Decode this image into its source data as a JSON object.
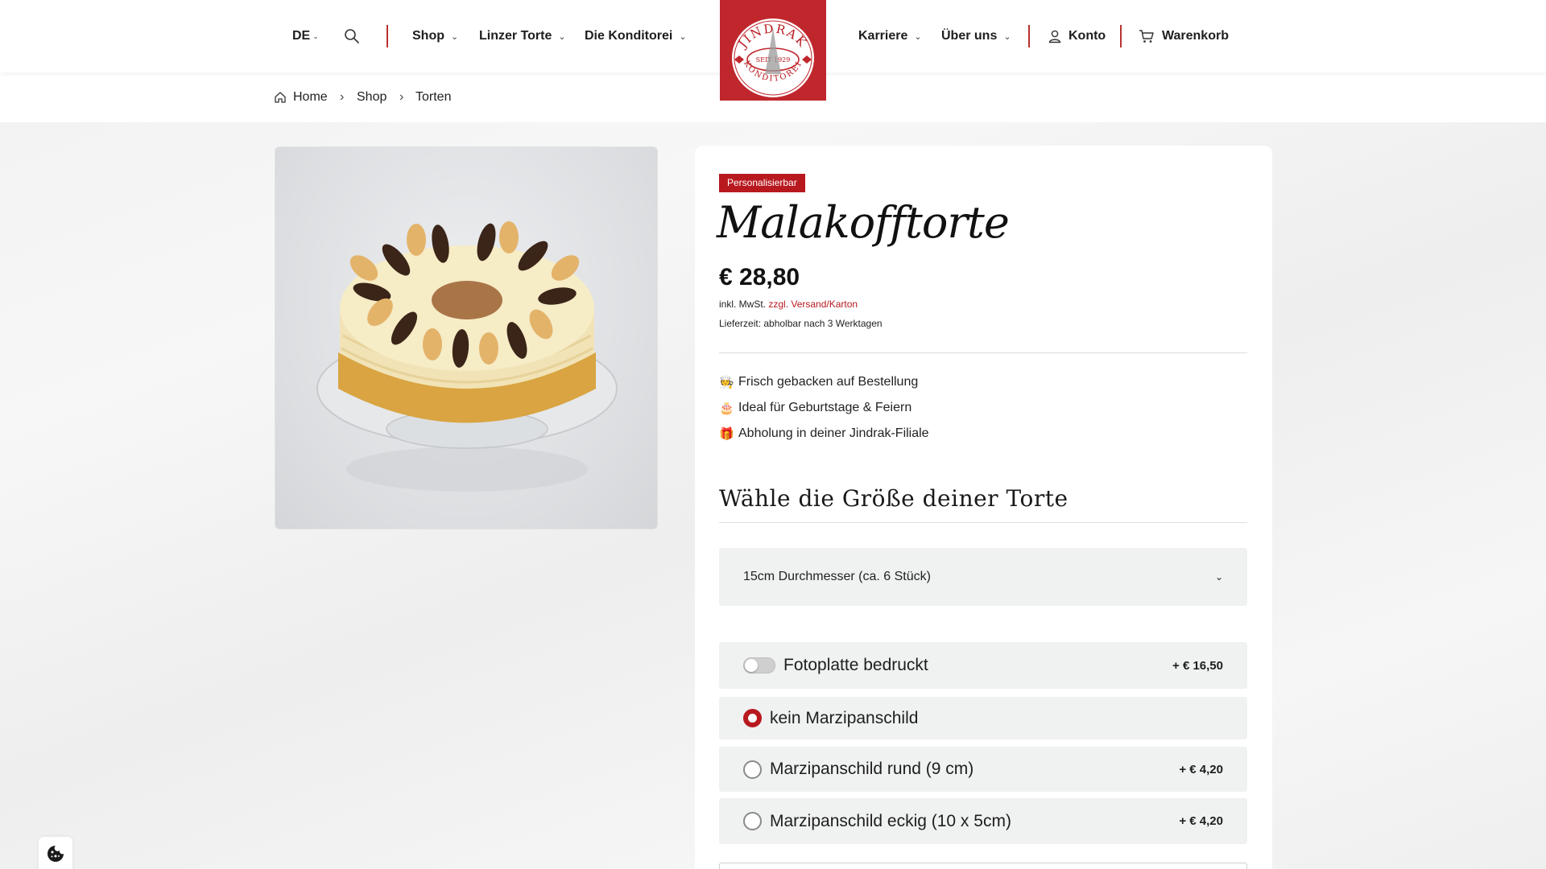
{
  "header": {
    "language": "DE",
    "nav_left": [
      {
        "label": "Shop"
      },
      {
        "label": "Linzer Torte"
      },
      {
        "label": "Die Konditorei"
      }
    ],
    "nav_right": [
      {
        "label": "Karriere"
      },
      {
        "label": "Über uns"
      }
    ],
    "account_label": "Konto",
    "cart_label": "Warenkorb",
    "logo": {
      "top": "JINDRAK",
      "middle": "SEIT 1929",
      "bottom": "KONDITOREI"
    }
  },
  "breadcrumb": [
    "Home",
    "Shop",
    "Torten"
  ],
  "product": {
    "badge": "Personalisierbar",
    "title": "Malakofftorte",
    "price": "€ 28,80",
    "tax_prefix": "inkl. MwSt.",
    "tax_link": "zzgl. Versand/Karton",
    "delivery": "Lieferzeit: abholbar nach 3 Werktagen",
    "features": [
      {
        "icon": "🧑‍🍳",
        "text": "Frisch gebacken auf Bestellung"
      },
      {
        "icon": "🎂",
        "text": "Ideal für Geburtstage & Feiern"
      },
      {
        "icon": "🎁",
        "text": "Abholung in deiner Jindrak-Filiale"
      }
    ],
    "size_heading": "Wähle die Größe deiner Torte",
    "size_selected": "15cm Durchmesser (ca. 6 Stück)",
    "options": {
      "photo": {
        "label": "Fotoplatte bedruckt",
        "price": "+ € 16,50",
        "enabled": false
      },
      "marzipan": [
        {
          "label": "kein Marzipanschild",
          "price": "",
          "checked": true
        },
        {
          "label": "Marzipanschild rund (9 cm)",
          "price": "+ € 4,20",
          "checked": false
        },
        {
          "label": "Marzipanschild eckig (10 x 5cm)",
          "price": "+ € 4,20",
          "checked": false
        }
      ]
    }
  },
  "colors": {
    "brand_red": "#b8191f",
    "logo_red": "#c0272d",
    "option_bg": "#f0f1f1"
  }
}
